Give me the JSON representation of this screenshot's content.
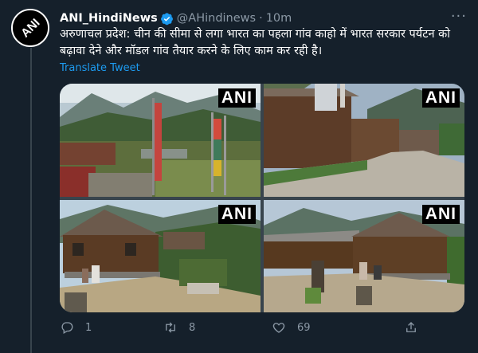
{
  "colors": {
    "background": "#15202b",
    "link": "#1d9bf0",
    "muted": "#8b98a5",
    "verified": "#1d9bf0"
  },
  "tweet": {
    "author_name": "ANI_HindiNews",
    "handle": "@AHindinews",
    "separator": "·",
    "time": "10m",
    "text": "अरुणाचल प्रदेश: चीन की सीमा से लगा भारत का पहला गांव काहो में भारत सरकार पर्यटन को बढ़ावा देने और मॉडल गांव तैयार करने के लिए काम कर रही है।",
    "translate_label": "Translate Tweet",
    "more_label": "···",
    "avatar_logo": "ANI",
    "media": [
      {
        "watermark": "ANI"
      },
      {
        "watermark": "ANI"
      },
      {
        "watermark": "ANI"
      },
      {
        "watermark": "ANI"
      }
    ],
    "actions": {
      "reply_count": "1",
      "retweet_count": "8",
      "like_count": "69"
    }
  },
  "icons": [
    "verified-badge-icon",
    "more-icon",
    "reply-icon",
    "retweet-icon",
    "like-icon",
    "share-icon"
  ]
}
